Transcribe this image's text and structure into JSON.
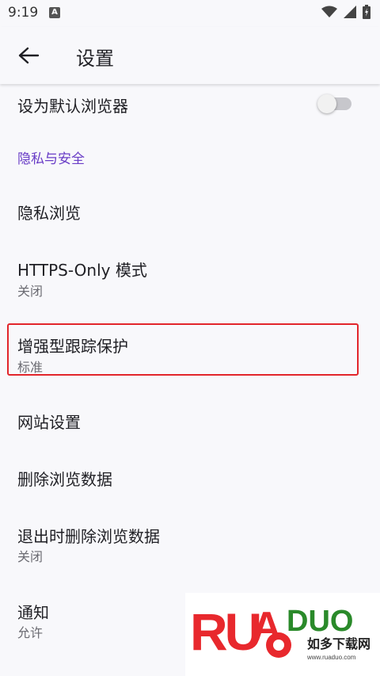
{
  "status_bar": {
    "time": "9:19",
    "app_icon_letter": "A"
  },
  "app_bar": {
    "title": "设置"
  },
  "settings": {
    "default_browser": {
      "title": "设为默认浏览器",
      "toggle_on": false
    },
    "section_privacy": "隐私与安全",
    "private_browsing": {
      "title": "隐私浏览"
    },
    "https_only": {
      "title": "HTTPS-Only 模式",
      "subtitle": "关闭"
    },
    "tracking_protection": {
      "title": "增强型跟踪保护",
      "subtitle": "标准"
    },
    "site_settings": {
      "title": "网站设置"
    },
    "delete_browsing_data": {
      "title": "删除浏览数据"
    },
    "delete_on_quit": {
      "title": "退出时删除浏览数据",
      "subtitle": "关闭"
    },
    "notifications": {
      "title": "通知",
      "subtitle": "允许"
    }
  },
  "watermark": {
    "logo_text": "RUANDUO",
    "tagline": "如多下载网",
    "url": "www.ruaduo.com"
  },
  "colors": {
    "accent": "#6a3ec7",
    "highlight": "#e2252b",
    "background": "#f8f8fb"
  }
}
